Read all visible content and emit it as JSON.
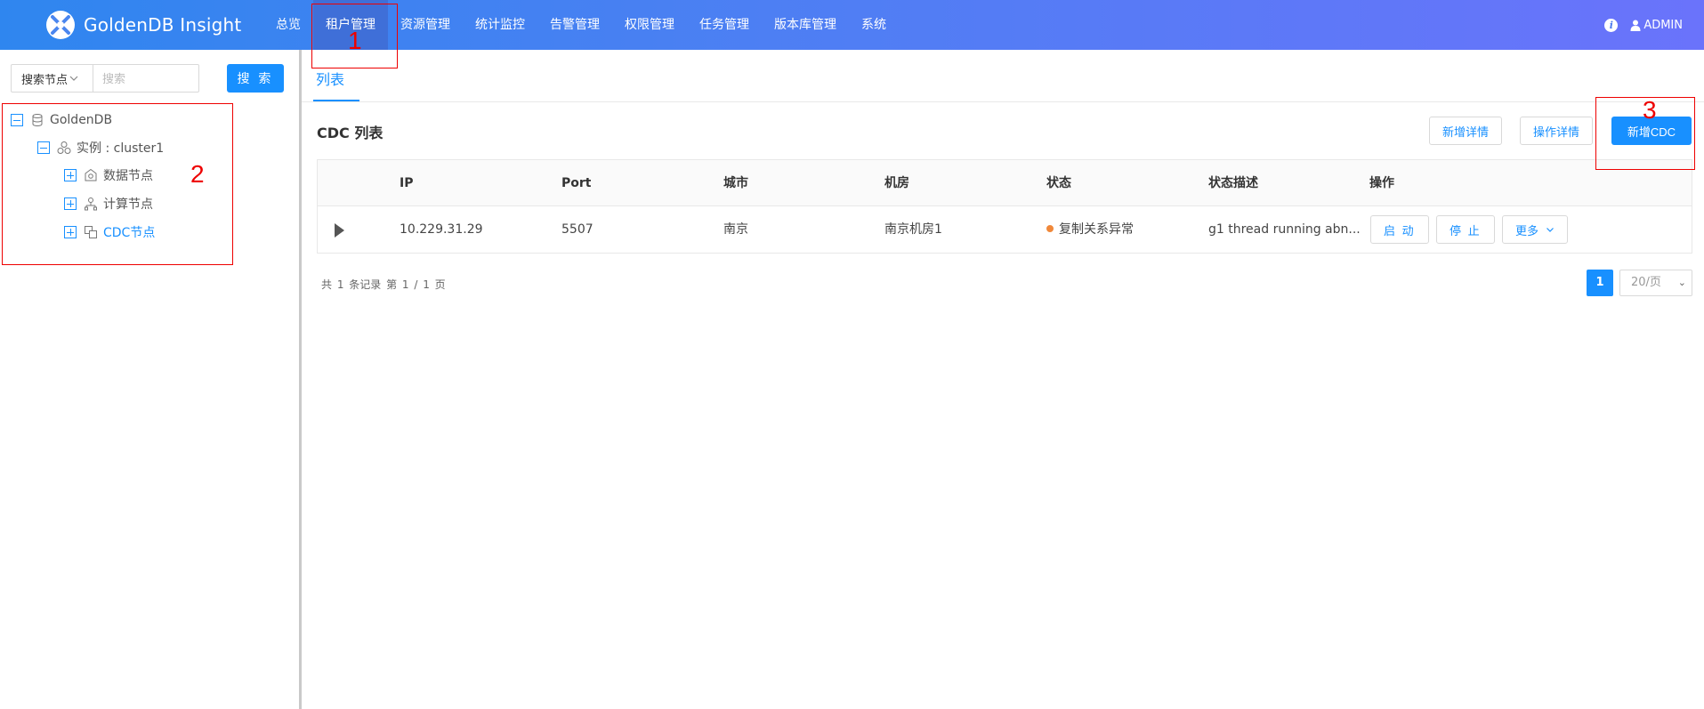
{
  "app": {
    "title": "GoldenDB Insight"
  },
  "nav": {
    "items": [
      "总览",
      "租户管理",
      "资源管理",
      "统计监控",
      "告警管理",
      "权限管理",
      "任务管理",
      "版本库管理",
      "系统"
    ],
    "active_index": 1
  },
  "header": {
    "user": "ADMIN",
    "info_icon": "info-icon",
    "user_icon": "user-icon"
  },
  "sidebar": {
    "search_select": "搜索节点",
    "search_placeholder": "搜索",
    "search_value": "",
    "search_button": "搜 索",
    "tree": [
      {
        "label": "GoldenDB",
        "icon": "database-icon",
        "expanded": true
      },
      {
        "label": "实例 : cluster1",
        "icon": "cluster-icon",
        "expanded": true
      },
      {
        "label": "数据节点",
        "icon": "data-node-icon",
        "expanded": false
      },
      {
        "label": "计算节点",
        "icon": "compute-node-icon",
        "expanded": false
      },
      {
        "label": "CDC节点",
        "icon": "cdc-node-icon",
        "expanded": false,
        "selected": true
      }
    ]
  },
  "main": {
    "tab": "列表",
    "section_title": "CDC 列表",
    "buttons": {
      "add_detail": "新增详情",
      "op_detail": "操作详情",
      "add_cdc": "新增CDC"
    },
    "table": {
      "columns": [
        "IP",
        "Port",
        "城市",
        "机房",
        "状态",
        "状态描述",
        "操作"
      ],
      "rows": [
        {
          "ip": "10.229.31.29",
          "port": "5507",
          "city": "南京",
          "room": "南京机房1",
          "status": "复制关系异常",
          "status_color": "#f0883a",
          "status_desc": "g1 thread running abn...",
          "actions": {
            "start": "启 动",
            "stop": "停 止",
            "more": "更多"
          }
        }
      ]
    },
    "pagination": {
      "summary": "共 1 条记录  第 1 / 1 页",
      "current_page": "1",
      "page_size": "20/页"
    }
  },
  "annotations": {
    "box1": "1",
    "box2": "2",
    "box3": "3"
  },
  "colors": {
    "primary": "#1890ff",
    "annotation": "#ee0000"
  }
}
